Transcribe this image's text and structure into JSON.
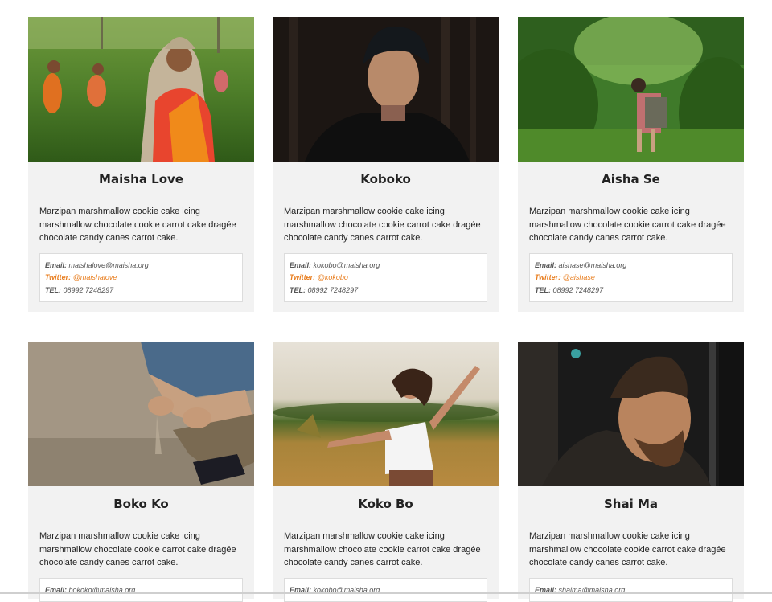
{
  "cards": [
    {
      "name": "Maisha Love",
      "description": "Marzipan marshmallow cookie cake icing marshmallow chocolate cookie carrot cake dragée chocolate candy canes carrot cake.",
      "email_label": "Email:",
      "email": "maishalove@maisha.org",
      "twitter_label": "Twitter:",
      "twitter": "@maishalove",
      "tel_label": "TEL:",
      "tel": "08992 7248297",
      "photo": "tea-field-woman-photo"
    },
    {
      "name": "Koboko",
      "description": "Marzipan marshmallow cookie cake icing marshmallow chocolate cookie carrot cake dragée chocolate candy canes carrot cake.",
      "email_label": "Email:",
      "email": "kokobo@maisha.org",
      "twitter_label": "Twitter:",
      "twitter": "@kokobo",
      "tel_label": "TEL:",
      "tel": "08992 7248297",
      "photo": "man-beanie-forest-photo"
    },
    {
      "name": "Aisha Se",
      "description": "Marzipan marshmallow cookie cake icing marshmallow chocolate cookie carrot cake dragée chocolate candy canes carrot cake.",
      "email_label": "Email:",
      "email": "aishase@maisha.org",
      "twitter_label": "Twitter:",
      "twitter": "@aishase",
      "tel_label": "TEL:",
      "tel": "08992 7248297",
      "photo": "hiker-green-forest-photo"
    },
    {
      "name": "Boko Ko",
      "description": "Marzipan marshmallow cookie cake icing marshmallow chocolate cookie carrot cake dragée chocolate candy canes carrot cake.",
      "email_label": "Email:",
      "email": "bokoko@maisha.org",
      "photo": "hands-sand-photo"
    },
    {
      "name": "Koko Bo",
      "description": "Marzipan marshmallow cookie cake icing marshmallow chocolate cookie carrot cake dragée chocolate candy canes carrot cake.",
      "email_label": "Email:",
      "email": "kokobo@maisha.org",
      "photo": "woman-field-dancing-photo"
    },
    {
      "name": "Shai Ma",
      "description": "Marzipan marshmallow cookie cake icing marshmallow chocolate cookie carrot cake dragée chocolate candy canes carrot cake.",
      "email_label": "Email:",
      "email": "shaima@maisha.org",
      "photo": "bearded-man-profile-photo"
    }
  ],
  "colors": {
    "card_bg": "#f2f2f2",
    "twitter_accent": "#e87d1e",
    "text": "#222222"
  }
}
